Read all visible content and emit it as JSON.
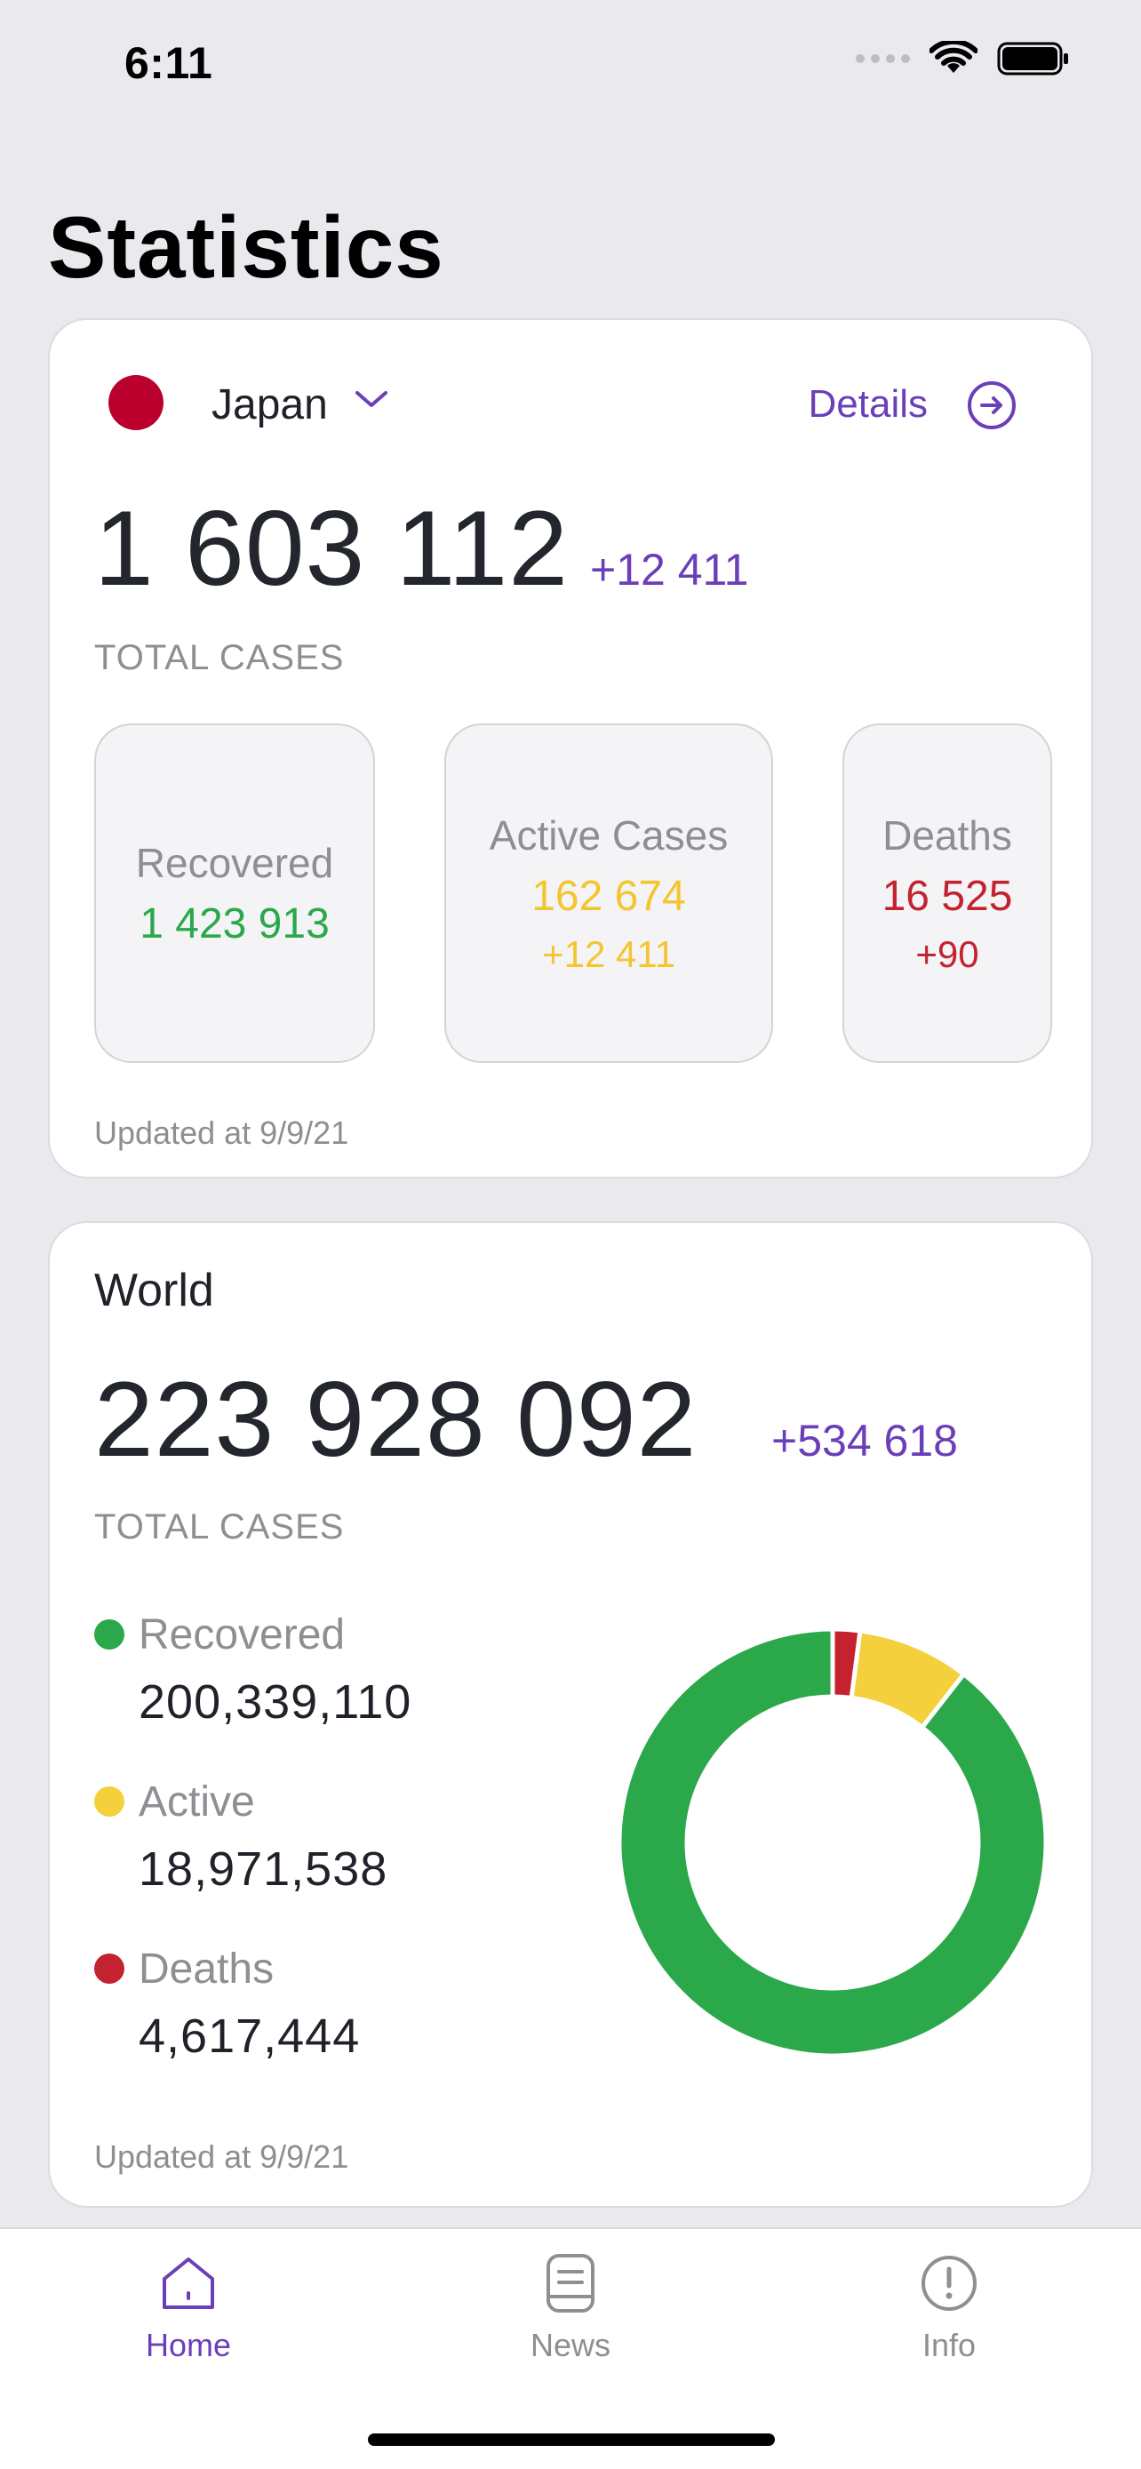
{
  "status_bar": {
    "time": "6:11"
  },
  "page": {
    "title": "Statistics"
  },
  "country_card": {
    "country": "Japan",
    "details_label": "Details",
    "total_cases": "1 603 112",
    "total_delta": "+12 411",
    "total_label": "TOTAL CASES",
    "stats": [
      {
        "title": "Recovered",
        "value": "1 423 913",
        "delta": ""
      },
      {
        "title": "Active Cases",
        "value": "162 674",
        "delta": "+12 411"
      },
      {
        "title": "Deaths",
        "value": "16 525",
        "delta": "+90"
      }
    ],
    "updated": "Updated at 9/9/21"
  },
  "world_card": {
    "title": "World",
    "total_cases": "223 928 092",
    "total_delta": "+534 618",
    "total_label": "TOTAL CASES",
    "legend": [
      {
        "label": "Recovered",
        "value": "200,339,110",
        "color": "#2aa84a"
      },
      {
        "label": "Active",
        "value": "18,971,538",
        "color": "#f3d03c"
      },
      {
        "label": "Deaths",
        "value": "4,617,444",
        "color": "#c4222f"
      }
    ],
    "updated": "Updated at 9/9/21"
  },
  "chart_data": {
    "type": "pie",
    "categories": [
      "Recovered",
      "Active",
      "Deaths"
    ],
    "values": [
      200339110,
      18971538,
      4617444
    ],
    "colors": [
      "#2aa84a",
      "#f3d03c",
      "#c4222f"
    ],
    "donut": true
  },
  "tab_bar": {
    "tabs": [
      {
        "label": "Home",
        "icon": "home-icon",
        "active": true
      },
      {
        "label": "News",
        "icon": "news-icon",
        "active": false
      },
      {
        "label": "Info",
        "icon": "info-icon",
        "active": false
      }
    ]
  },
  "colors": {
    "accent": "#6b3fb8",
    "inactive": "#8e8e93"
  }
}
